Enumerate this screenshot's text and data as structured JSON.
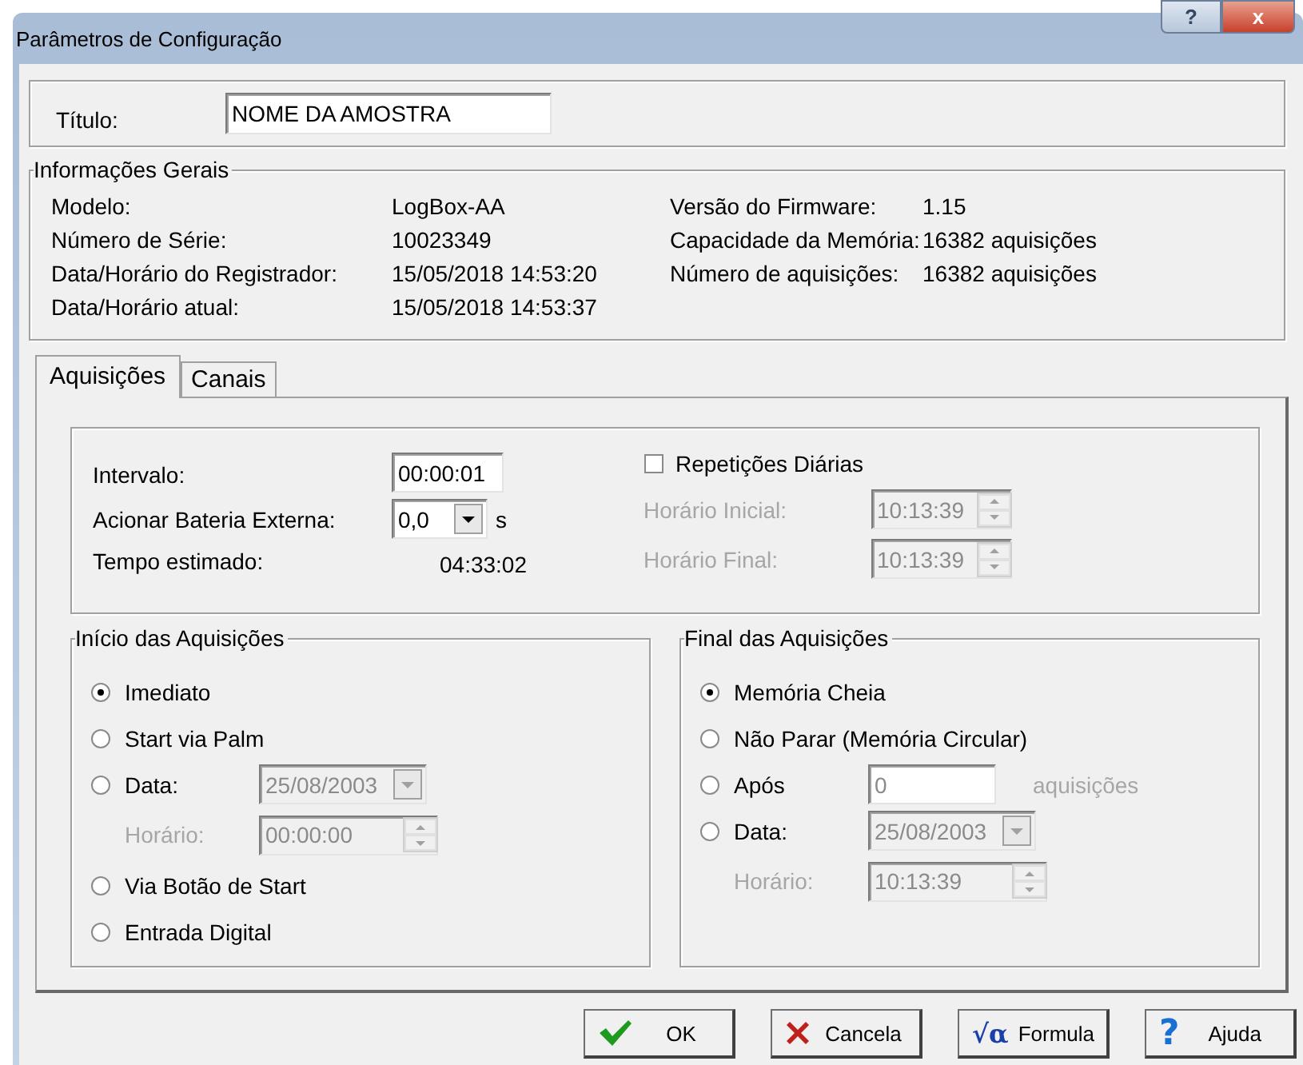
{
  "window": {
    "title": "Parâmetros de Configuração",
    "help_button": "?",
    "close_button": "x"
  },
  "title_field": {
    "label": "Título:",
    "value": "NOME DA AMOSTRA"
  },
  "general_info": {
    "legend": "Informações Gerais",
    "left": [
      {
        "label": "Modelo:",
        "value": "LogBox-AA"
      },
      {
        "label": "Número de Série:",
        "value": "10023349"
      },
      {
        "label": "Data/Horário do Registrador:",
        "value": "15/05/2018 14:53:20"
      },
      {
        "label": "Data/Horário atual:",
        "value": "15/05/2018 14:53:37"
      }
    ],
    "right": [
      {
        "label": "Versão do Firmware:",
        "value": "1.15"
      },
      {
        "label": "Capacidade da Memória:",
        "value": "16382 aquisições"
      },
      {
        "label": "Número de aquisições:",
        "value": "16382 aquisições"
      }
    ]
  },
  "tabs": [
    {
      "label": "Aquisições",
      "selected": true
    },
    {
      "label": "Canais",
      "selected": false
    }
  ],
  "acquisition": {
    "interval": {
      "label": "Intervalo:",
      "value": "00:00:01"
    },
    "external_battery": {
      "label": "Acionar Bateria Externa:",
      "value": "0,0",
      "unit": "s"
    },
    "estimated_time": {
      "label": "Tempo estimado:",
      "value": "04:33:02"
    },
    "daily_repeat": {
      "label": "Repetições Diárias",
      "checked": false
    },
    "start_time": {
      "label": "Horário Inicial:",
      "value": "10:13:39",
      "disabled": true
    },
    "end_time": {
      "label": "Horário Final:",
      "value": "10:13:39",
      "disabled": true
    }
  },
  "start": {
    "legend": "Início das Aquisições",
    "options": [
      {
        "kind": "plain",
        "label": "Imediato",
        "selected": true
      },
      {
        "kind": "plain",
        "label": "Start via Palm",
        "selected": false
      },
      {
        "kind": "date",
        "label": "Data:",
        "selected": false,
        "disabled": true,
        "date": "25/08/2003",
        "time_label": "Horário:",
        "time": "00:00:00"
      },
      {
        "kind": "plain",
        "label": "Via Botão de Start",
        "selected": false
      },
      {
        "kind": "plain",
        "label": "Entrada Digital",
        "selected": false
      }
    ]
  },
  "end": {
    "legend": "Final das Aquisições",
    "options": [
      {
        "kind": "plain",
        "label": "Memória Cheia",
        "selected": true
      },
      {
        "kind": "plain",
        "label": "Não Parar (Memória Circular)",
        "selected": false
      },
      {
        "kind": "count",
        "label": "Após",
        "selected": false,
        "disabled": true,
        "value": "0",
        "unit": "aquisições"
      },
      {
        "kind": "date",
        "label": "Data:",
        "selected": false,
        "disabled": true,
        "date": "25/08/2003",
        "time_label": "Horário:",
        "time": "10:13:39"
      }
    ]
  },
  "buttons": [
    {
      "kind": "ok",
      "label": "OK"
    },
    {
      "kind": "cancel",
      "label": "Cancela"
    },
    {
      "kind": "formula",
      "label": "Formula",
      "icon": "√α"
    },
    {
      "kind": "help",
      "label": "Ajuda",
      "icon": "?"
    }
  ]
}
